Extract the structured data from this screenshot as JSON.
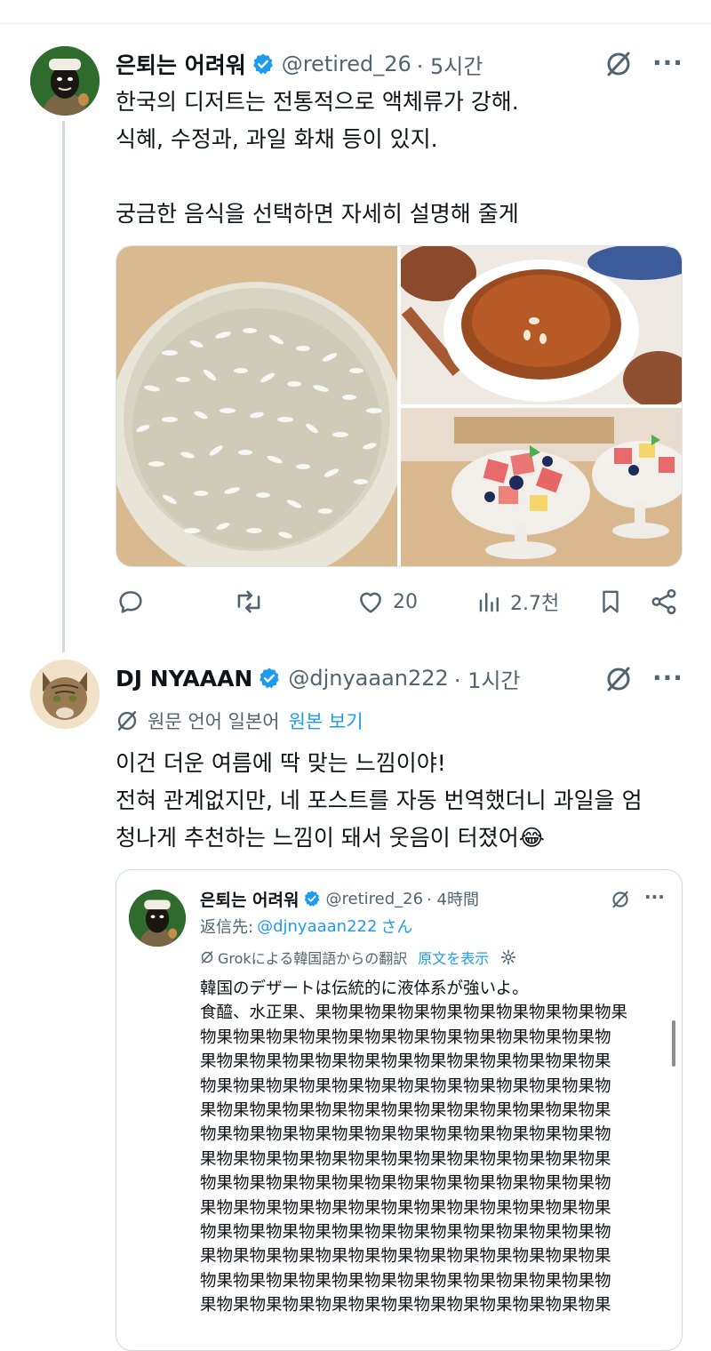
{
  "post": {
    "author_name": "은퇴는 어려워",
    "handle": "@retired_26",
    "time": "· 5시간",
    "body_lines": [
      "한국의 디저트는 전통적으로 액체류가 강해.",
      "식혜, 수정과, 과일 화채 등이 있지.",
      "",
      "궁금한 음식을 선택하면 자세히 설명해 줄게"
    ],
    "images": [
      "sikhye-photo",
      "sujeonggwa-photo",
      "hwachae-photo"
    ],
    "stats": {
      "likes": "20",
      "views": "2.7천"
    }
  },
  "reply": {
    "author_name": "DJ NYAAAN",
    "handle": "@djnyaaan222",
    "time": "· 1시간",
    "translation_label": "원문 언어 일본어",
    "show_original": "원본 보기",
    "body_lines": [
      "이건 더운 여름에 딱 맞는 느낌이야!",
      "전혀 관계없지만, 네 포스트를 자동 번역했더니 과일을 엄",
      "청나게 추천하는 느낌이 돼서 웃음이 터졌어😂"
    ]
  },
  "quote": {
    "author_name": "은퇴는 어려워",
    "handle": "@retired_26",
    "time": "· 4時間",
    "reply_prefix": "返信先:",
    "reply_to": "@djnyaaan222",
    "reply_suffix": "さん",
    "grok_label": "Grokによる韓国語からの翻訳",
    "show_original": "原文を表示",
    "body_lines": [
      "韓国のデザートは伝統的に液体系が強いよ。",
      "食醯、水正果、果物果物果物果物果物果物果物果物果物果",
      "物果物果物果物果物果物果物果物果物果物果物果物果物",
      "果物果物果物果物果物果物果物果物果物果物果物果物果",
      "物果物果物果物果物果物果物果物果物果物果物果物果物",
      "果物果物果物果物果物果物果物果物果物果物果物果物果",
      "物果物果物果物果物果物果物果物果物果物果物果物果物",
      "果物果物果物果物果物果物果物果物果物果物果物果物果",
      "物果物果物果物果物果物果物果物果物果物果物果物果物",
      "果物果物果物果物果物果物果物果物果物果物果物果物果",
      "物果物果物果物果物果物果物果物果物果物果物果物果物",
      "果物果物果物果物果物果物果物果物果物果物果物果物果",
      "物果物果物果物果物果物果物果物果物果物果物果物果物",
      "果物果物果物果物果物果物果物果物果物果物果物果物果"
    ]
  },
  "colors": {
    "text": "#0f1419",
    "muted": "#536471",
    "link": "#1d9bf0",
    "verified": "#1d9bf0"
  }
}
